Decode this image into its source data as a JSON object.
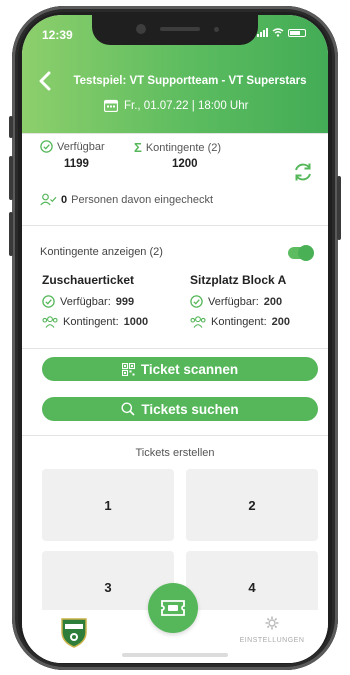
{
  "status_bar": {
    "time": "12:39"
  },
  "header": {
    "title": "Testspiel: VT Supportteam - VT Superstars",
    "datetime": "Fr., 01.07.22 | 18:00 Uhr"
  },
  "stats": {
    "available_label": "Verfügbar",
    "available_value": "1199",
    "quota_label": "Kontingente (2)",
    "quota_value": "1200",
    "checked_in_count": "0",
    "checked_in_text": "Personen davon eingecheckt"
  },
  "quota_toggle": {
    "label": "Kontingente anzeigen (2)",
    "on": true
  },
  "quotas": [
    {
      "name": "Zuschauerticket",
      "available_label": "Verfügbar:",
      "available": "999",
      "quota_label": "Kontingent:",
      "quota": "1000"
    },
    {
      "name": "Sitzplatz Block A",
      "available_label": "Verfügbar:",
      "available": "200",
      "quota_label": "Kontingent:",
      "quota": "200"
    }
  ],
  "actions": {
    "scan_label": "Ticket scannen",
    "search_label": "Tickets suchen"
  },
  "create_section": {
    "label": "Tickets erstellen",
    "tiles": [
      "1",
      "2",
      "3",
      "4"
    ]
  },
  "tabbar": {
    "settings_label": "EINSTELLUNGEN"
  },
  "colors": {
    "accent": "#55b75a",
    "header_start": "#8dcf6c",
    "header_end": "#43ac56"
  }
}
